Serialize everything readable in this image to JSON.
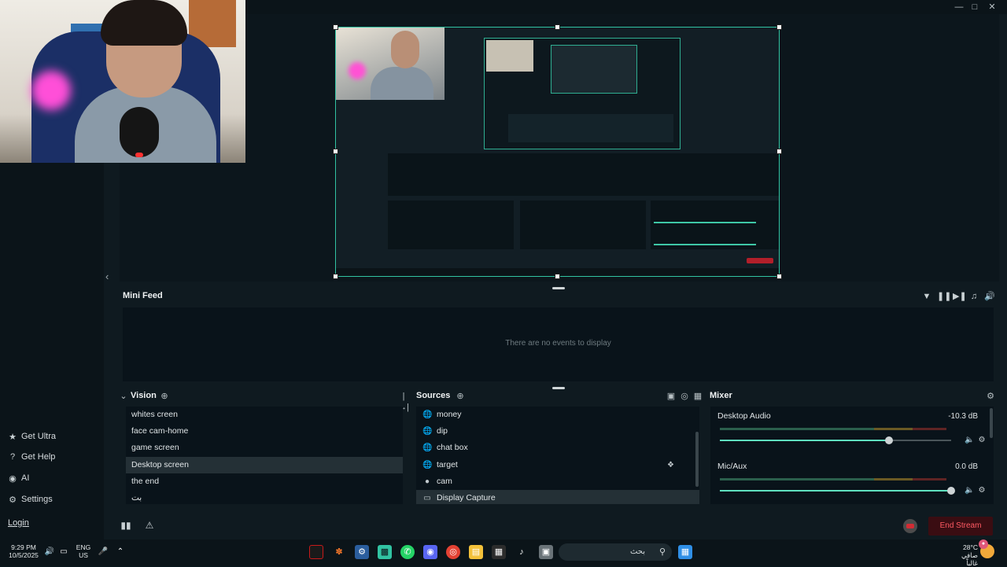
{
  "window": {
    "minimize": "—",
    "maximize": "□",
    "close": "✕"
  },
  "sidebar": {
    "items": [
      {
        "label": "Get Ultra",
        "icon": "ultra-icon"
      },
      {
        "label": "Get Help",
        "icon": "help-icon"
      },
      {
        "label": "AI",
        "icon": "eye-icon"
      },
      {
        "label": "Settings",
        "icon": "gear-icon"
      }
    ],
    "login": "Login"
  },
  "mini_feed": {
    "title": "Mini Feed",
    "empty_message": "There are no events to display"
  },
  "vision": {
    "title": "Vision",
    "items": [
      "whites creen",
      "face cam-home",
      "game screen",
      "Desktop screen",
      "the end",
      "بت"
    ],
    "selected": "Desktop screen"
  },
  "sources": {
    "title": "Sources",
    "items": [
      {
        "label": "money",
        "icon": "globe-icon"
      },
      {
        "label": "dip",
        "icon": "globe-icon"
      },
      {
        "label": "chat box",
        "icon": "globe-icon"
      },
      {
        "label": "target",
        "icon": "globe-icon"
      },
      {
        "label": "cam",
        "icon": "webcam-icon"
      },
      {
        "label": "Display Capture",
        "icon": "monitor-icon"
      }
    ],
    "selected": "Display Capture"
  },
  "mixer": {
    "title": "Mixer",
    "channels": [
      {
        "name": "Desktop Audio",
        "db": "-10.3 dB",
        "level": 0.73
      },
      {
        "name": "Mic/Aux",
        "db": "0.0 dB",
        "level": 1.0
      }
    ]
  },
  "footer": {
    "rec_label": "REC",
    "end_stream": "End Stream"
  },
  "taskbar": {
    "time": "9:29 PM",
    "date": "10/5/2025",
    "lang_1": "ENG",
    "lang_2": "US",
    "search": "بحث",
    "temp": "28°C",
    "weather": "صافي غالباً"
  },
  "colors": {
    "accent": "#31c3a2",
    "end_stream": "#ff5a63",
    "selected_row": "#243036"
  }
}
